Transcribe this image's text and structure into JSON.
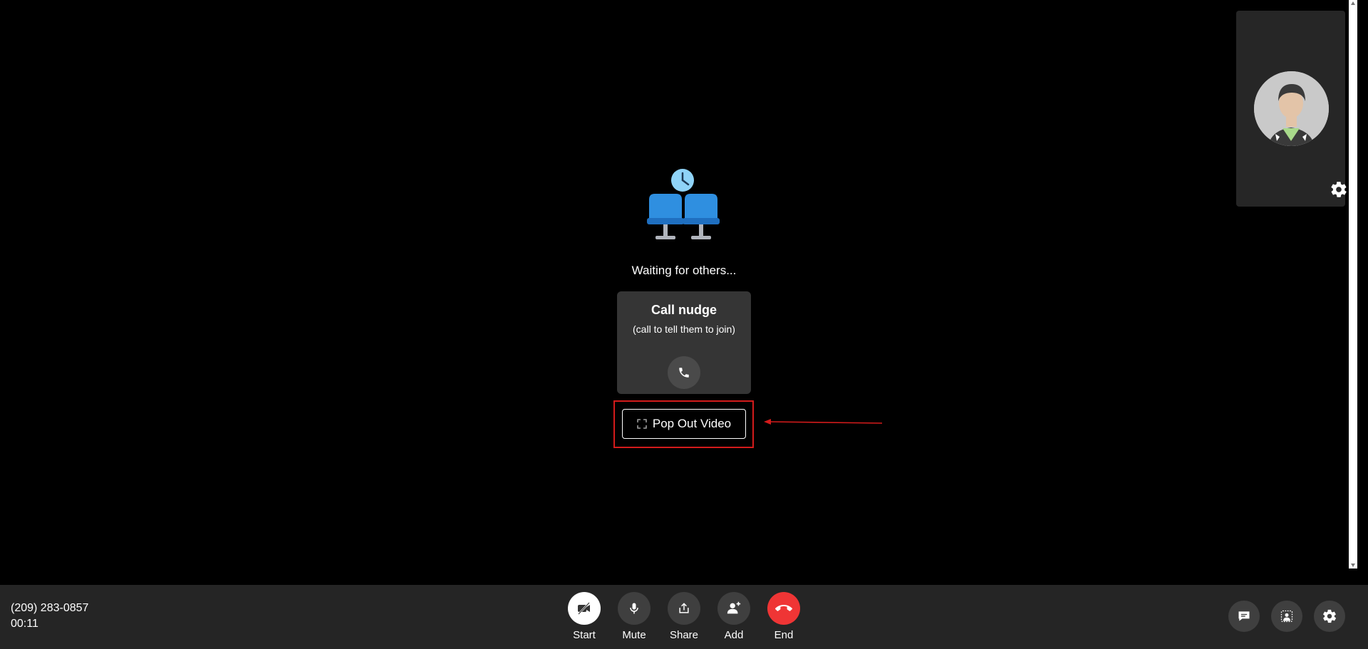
{
  "waiting": {
    "text": "Waiting for others..."
  },
  "nudge": {
    "title": "Call nudge",
    "subtitle": "(call to tell them to join)",
    "call_icon": "phone-icon"
  },
  "popout": {
    "label": "Pop Out Video",
    "icon": "pop-out-icon"
  },
  "annotation": {
    "highlight_color": "#d31b1b",
    "arrow_color": "#d31b1b"
  },
  "call_info": {
    "phone": "(209) 283-0857",
    "duration": "00:11"
  },
  "controls": [
    {
      "id": "start",
      "label": "Start",
      "icon": "video-off-icon"
    },
    {
      "id": "mute",
      "label": "Mute",
      "icon": "microphone-icon"
    },
    {
      "id": "share",
      "label": "Share",
      "icon": "share-icon"
    },
    {
      "id": "add",
      "label": "Add",
      "icon": "add-person-icon"
    },
    {
      "id": "end",
      "label": "End",
      "icon": "hang-up-icon"
    }
  ],
  "right_controls": [
    {
      "id": "chat",
      "icon": "chat-icon"
    },
    {
      "id": "effects",
      "icon": "background-effects-icon"
    },
    {
      "id": "settings",
      "icon": "gear-icon"
    }
  ],
  "colors": {
    "end_call": "#ef3535",
    "bar_background": "#252525",
    "card_background": "#353535",
    "seat_blue": "#2f8fe0",
    "clock_blue": "#8fd3f7"
  }
}
